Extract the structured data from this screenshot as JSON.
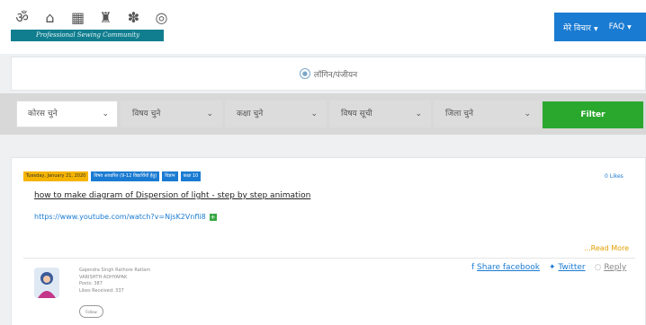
{
  "header": {
    "icon_names": [
      "spiritual-symbol-icon",
      "building-icon",
      "school-icon",
      "parliament-icon",
      "gear-icon",
      "globe-icon"
    ],
    "logo_text": "Professional Sewing Community",
    "nav": {
      "item1": "मेरे विचार",
      "item2": "FAQ"
    }
  },
  "login": {
    "label": "लॉगिन/पंजीयन"
  },
  "filters": {
    "course": "कोरस चुने",
    "subject": "विषय चुने",
    "class": "कक्षा चुने",
    "topic_list": "विषय सूची",
    "district": "जिला चुने",
    "filter_button": "Filter"
  },
  "post": {
    "date": "Tuesday, January 21, 2020",
    "badge_category": "विषय आधारित (9-12 विद्यार्थियों हेतु)",
    "badge_subject": "विज्ञान",
    "badge_class": "कक्षा 10",
    "likes": "0 Likes",
    "title": "how to make diagram of Dispersion of light - step by step animation",
    "link": "https://www.youtube.com/watch?v=NjsK2Vnfli8",
    "read_more": "...Read More"
  },
  "author": {
    "name": "Gajendra Singh Rathore Ratlam",
    "role": "VARISHTH ADHYAPAK",
    "posts": "Posts: 387",
    "likes_received": "Likes Received: 337",
    "pill": "Follow"
  },
  "actions": {
    "facebook": "Share facebook",
    "twitter": "Twitter",
    "reply": "Reply"
  },
  "colors": {
    "primary": "#1a7bd2",
    "filter_green": "#2aa82e",
    "logo_teal": "#117e8f",
    "date_badge": "#f5b400",
    "read_more": "#e3a000"
  }
}
